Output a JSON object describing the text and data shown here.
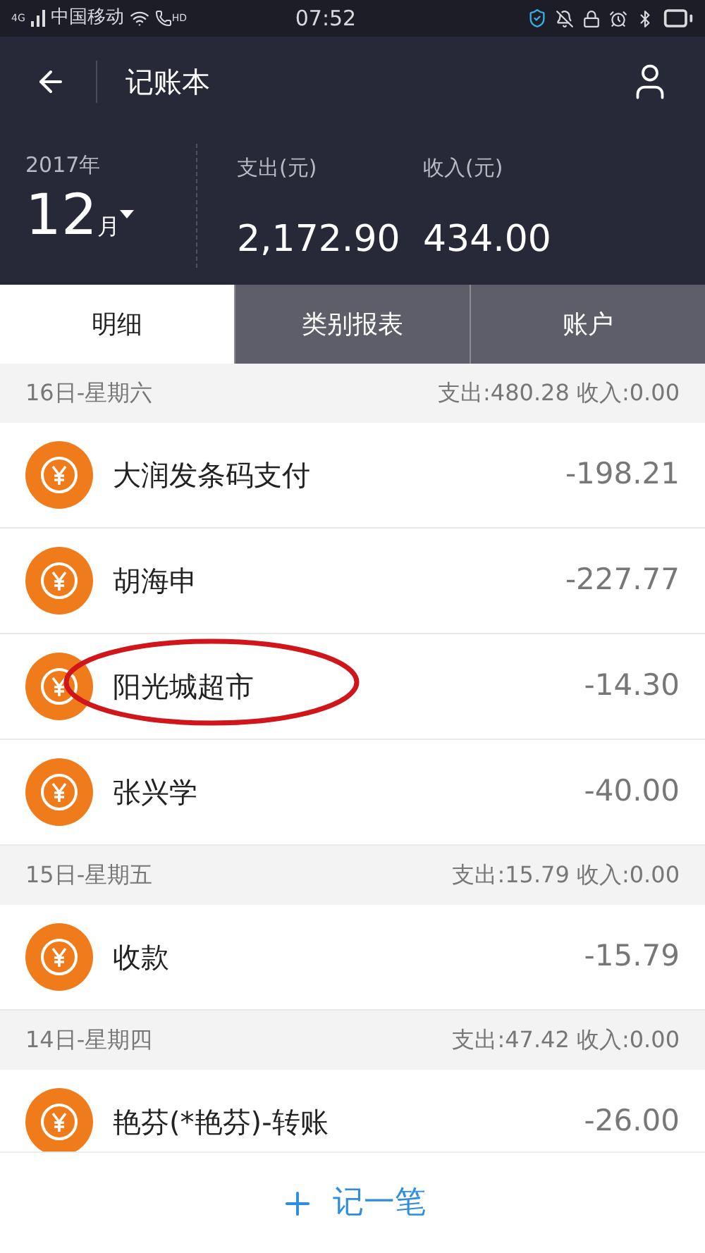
{
  "status_bar": {
    "network": "4G",
    "carrier": "中国移动",
    "call_badge": "HD",
    "time": "07:52"
  },
  "header": {
    "title": "记账本"
  },
  "summary": {
    "year": "2017年",
    "month": "12",
    "month_unit": "月",
    "expense_label": "支出(元)",
    "expense": "2,172.90",
    "income_label": "收入(元)",
    "income": "434.00"
  },
  "tabs": [
    {
      "label": "明细",
      "selected": true
    },
    {
      "label": "类别报表",
      "selected": false
    },
    {
      "label": "账户",
      "selected": false
    }
  ],
  "days": [
    {
      "date": "16日-星期六",
      "totals": "支出:480.28 收入:0.00",
      "entries": [
        {
          "name": "大润发条码支付",
          "amount": "-198.21",
          "highlighted": false
        },
        {
          "name": "胡海申",
          "amount": "-227.77",
          "highlighted": false
        },
        {
          "name": "阳光城超市",
          "amount": "-14.30",
          "highlighted": true
        },
        {
          "name": "张兴学",
          "amount": "-40.00",
          "highlighted": false
        }
      ]
    },
    {
      "date": "15日-星期五",
      "totals": "支出:15.79 收入:0.00",
      "entries": [
        {
          "name": "收款",
          "amount": "-15.79",
          "highlighted": false
        }
      ]
    },
    {
      "date": "14日-星期四",
      "totals": "支出:47.42 收入:0.00",
      "entries": [
        {
          "name": "艳芬(*艳芬)-转账",
          "amount": "-26.00",
          "highlighted": false
        }
      ]
    }
  ],
  "add_button": {
    "label": "记一笔"
  }
}
